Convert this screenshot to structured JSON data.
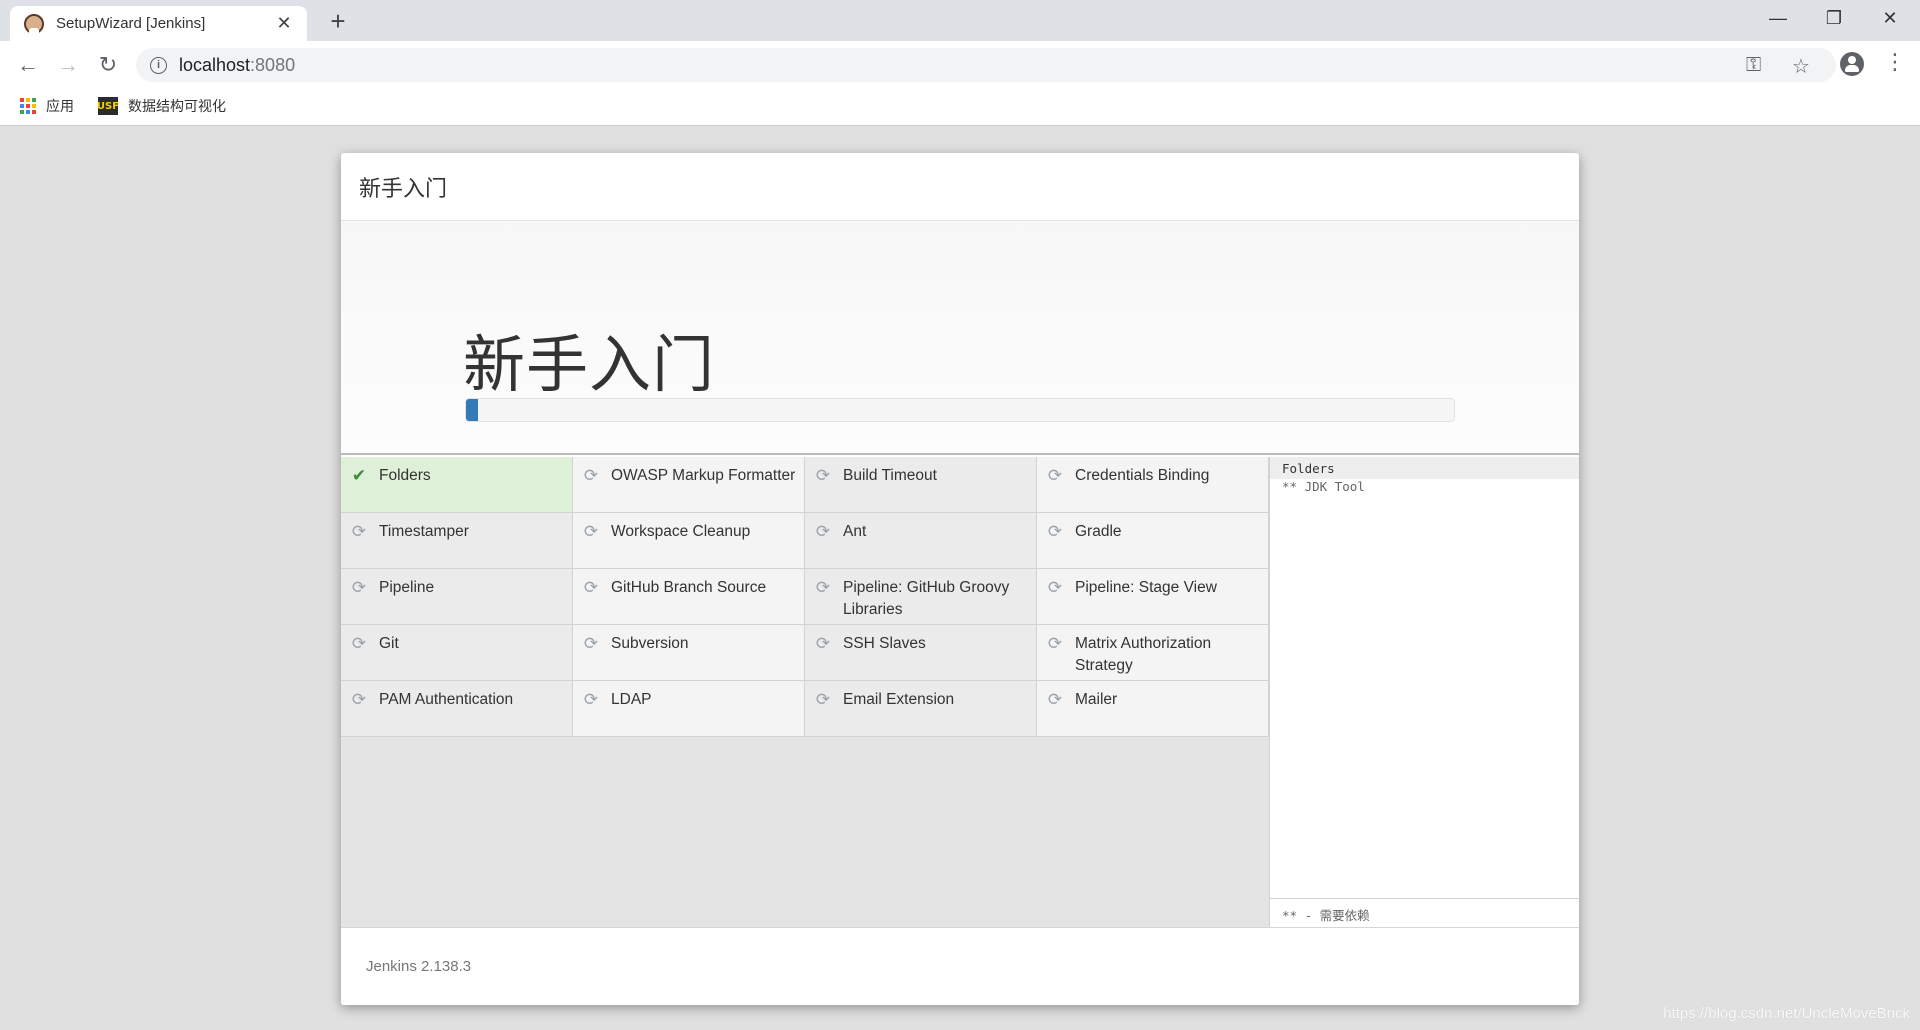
{
  "browser": {
    "tab_title": "SetupWizard [Jenkins]",
    "url_host": "localhost",
    "url_port": ":8080",
    "bookmarks": [
      {
        "label": "应用",
        "icon": "apps-grid-icon"
      },
      {
        "label": "数据结构可视化",
        "icon": "usf-icon",
        "icon_text": "USF"
      }
    ]
  },
  "wizard": {
    "header_title": "新手入门",
    "hero_title": "新手入门",
    "progress_percent": 1.2,
    "plugins": [
      {
        "name": "Folders",
        "status": "installed"
      },
      {
        "name": "OWASP Markup Formatter",
        "status": "pending"
      },
      {
        "name": "Build Timeout",
        "status": "pending"
      },
      {
        "name": "Credentials Binding",
        "status": "pending"
      },
      {
        "name": "Timestamper",
        "status": "pending"
      },
      {
        "name": "Workspace Cleanup",
        "status": "pending"
      },
      {
        "name": "Ant",
        "status": "pending"
      },
      {
        "name": "Gradle",
        "status": "pending"
      },
      {
        "name": "Pipeline",
        "status": "installing"
      },
      {
        "name": "GitHub Branch Source",
        "status": "pending"
      },
      {
        "name": "Pipeline: GitHub Groovy Libraries",
        "status": "installing"
      },
      {
        "name": "Pipeline: Stage View",
        "status": "pending"
      },
      {
        "name": "Git",
        "status": "pending"
      },
      {
        "name": "Subversion",
        "status": "pending"
      },
      {
        "name": "SSH Slaves",
        "status": "pending"
      },
      {
        "name": "Matrix Authorization Strategy",
        "status": "pending"
      },
      {
        "name": "PAM Authentication",
        "status": "pending"
      },
      {
        "name": "LDAP",
        "status": "pending"
      },
      {
        "name": "Email Extension",
        "status": "pending"
      },
      {
        "name": "Mailer",
        "status": "pending"
      }
    ],
    "log": {
      "current": "Folders",
      "lines": [
        "** JDK Tool"
      ],
      "legend": "** - 需要依赖"
    },
    "footer_version": "Jenkins 2.138.3"
  },
  "watermark": "https://blog.csdn.net/UncleMoveBrick",
  "colors": {
    "installed_bg": "#dff0d8",
    "progress": "#337ab7",
    "check": "#3c8c3c"
  }
}
